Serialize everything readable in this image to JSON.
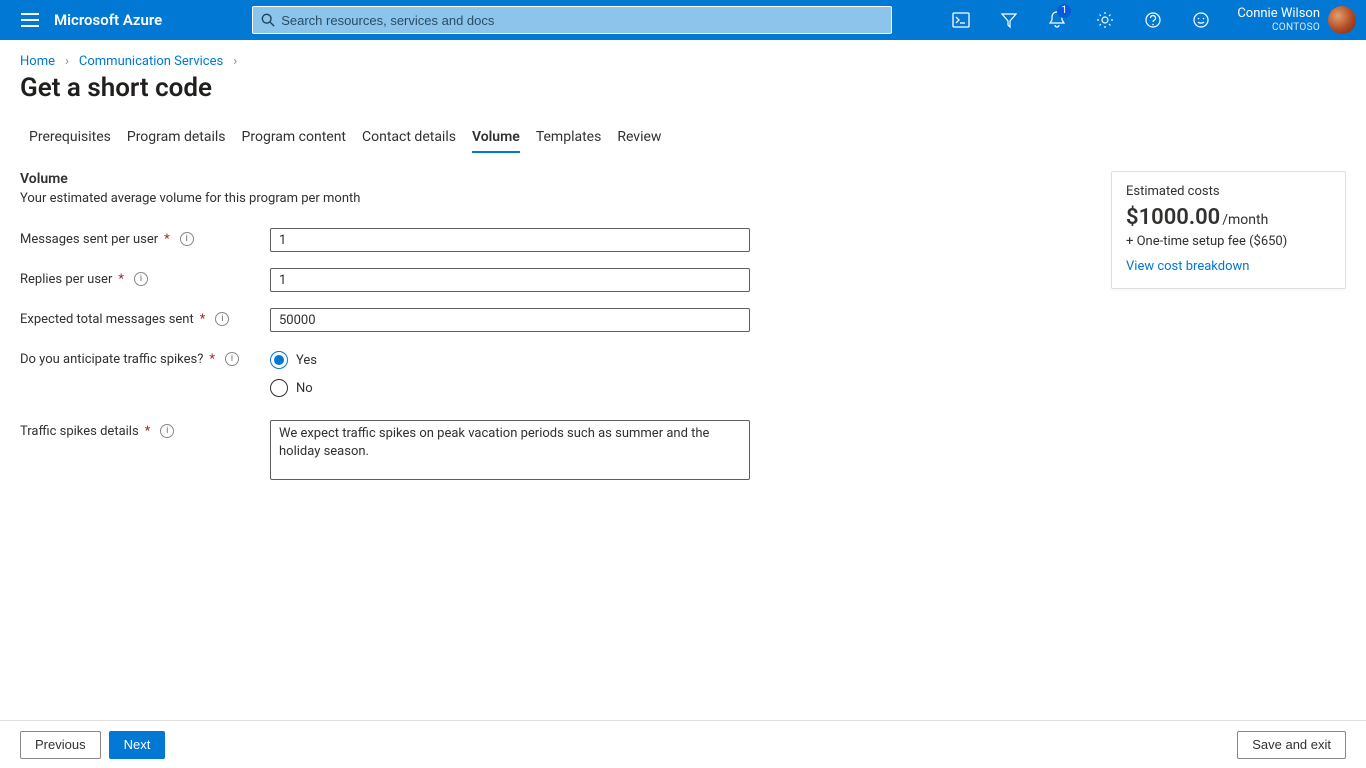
{
  "topbar": {
    "brand": "Microsoft Azure",
    "search_placeholder": "Search resources, services and docs",
    "notifications_badge": "1",
    "user_name": "Connie Wilson",
    "tenant": "CONTOSO"
  },
  "breadcrumb": {
    "items": [
      {
        "label": "Home"
      },
      {
        "label": "Communication Services"
      }
    ]
  },
  "page_title": "Get a short code",
  "tabs": [
    {
      "label": "Prerequisites"
    },
    {
      "label": "Program details"
    },
    {
      "label": "Program content"
    },
    {
      "label": "Contact details"
    },
    {
      "label": "Volume"
    },
    {
      "label": "Templates"
    },
    {
      "label": "Review"
    }
  ],
  "section": {
    "heading": "Volume",
    "description": "Your estimated average volume for this program per month"
  },
  "form": {
    "messages_sent_label": "Messages sent per user",
    "messages_sent_value": "1",
    "replies_label": "Replies per user",
    "replies_value": "1",
    "expected_total_label": "Expected total messages sent",
    "expected_total_value": "50000",
    "spikes_label": "Do you anticipate traffic spikes?",
    "spikes_yes": "Yes",
    "spikes_no": "No",
    "spikes_details_label": "Traffic spikes details",
    "spikes_details_value": "We expect traffic spikes on peak vacation periods such as summer and the holiday season."
  },
  "cost_card": {
    "title": "Estimated costs",
    "amount": "$1000.00",
    "suffix": "/month",
    "fee": "+ One-time setup fee ($650)",
    "link": "View cost breakdown"
  },
  "footer": {
    "previous": "Previous",
    "next": "Next",
    "save_exit": "Save and exit"
  }
}
